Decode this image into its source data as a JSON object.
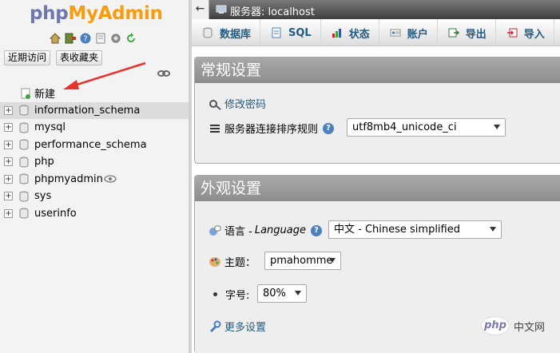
{
  "logo": {
    "part1": "php",
    "part2": "MyAdmin"
  },
  "nav": {
    "recent_label": "近期访问",
    "favorites_label": "表收藏夹",
    "new_label": "新建",
    "databases": [
      {
        "name": "information_schema",
        "highlighted": true
      },
      {
        "name": "mysql"
      },
      {
        "name": "performance_schema"
      },
      {
        "name": "php"
      },
      {
        "name": "phpmyadmin",
        "has_eye": true
      },
      {
        "name": "sys"
      },
      {
        "name": "userinfo"
      }
    ]
  },
  "server_bar": {
    "back": "←",
    "label": "服务器: localhost"
  },
  "tabs": [
    {
      "label": "数据库",
      "icon": "database-icon"
    },
    {
      "label": "SQL",
      "icon": "sql-icon"
    },
    {
      "label": "状态",
      "icon": "status-icon"
    },
    {
      "label": "账户",
      "icon": "accounts-icon"
    },
    {
      "label": "导出",
      "icon": "export-icon"
    },
    {
      "label": "导入",
      "icon": "import-icon"
    }
  ],
  "general": {
    "title": "常规设置",
    "change_password": "修改密码",
    "collation_label": "服务器连接排序规则",
    "collation_value": "utf8mb4_unicode_ci",
    "help": "?"
  },
  "appearance": {
    "title": "外观设置",
    "language_label": "语言 - ",
    "language_label_en": "Language",
    "language_value": "中文 - Chinese simplified",
    "theme_label": "主题：",
    "theme_value": "pmahomme",
    "fontsize_label": "字号:",
    "fontsize_value": "80%",
    "more_settings": "更多设置",
    "help": "?"
  },
  "watermark": {
    "badge": "php",
    "text": "中文网"
  },
  "colors": {
    "link": "#235a81",
    "logo_php": "#6c78af",
    "logo_admin": "#f89c0e",
    "arrow": "#e8322c"
  }
}
